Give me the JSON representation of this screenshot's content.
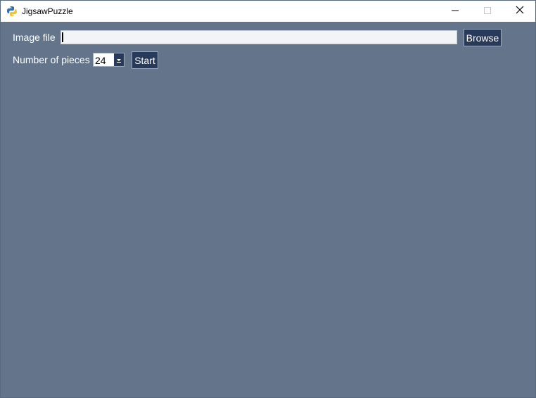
{
  "window": {
    "title": "JigsawPuzzle"
  },
  "form": {
    "image_file_label": "Image file",
    "image_file_value": "",
    "browse_label": "Browse",
    "pieces_label": "Number of pieces",
    "pieces_value": "24",
    "start_label": "Start"
  },
  "icons": {
    "app": "python-icon",
    "minimize": "minimize-icon",
    "maximize": "maximize-icon",
    "close": "close-icon",
    "dropdown": "chevron-down-icon"
  },
  "colors": {
    "background": "#64758b",
    "button": "#283a5a",
    "input": "#f2f4f8"
  }
}
